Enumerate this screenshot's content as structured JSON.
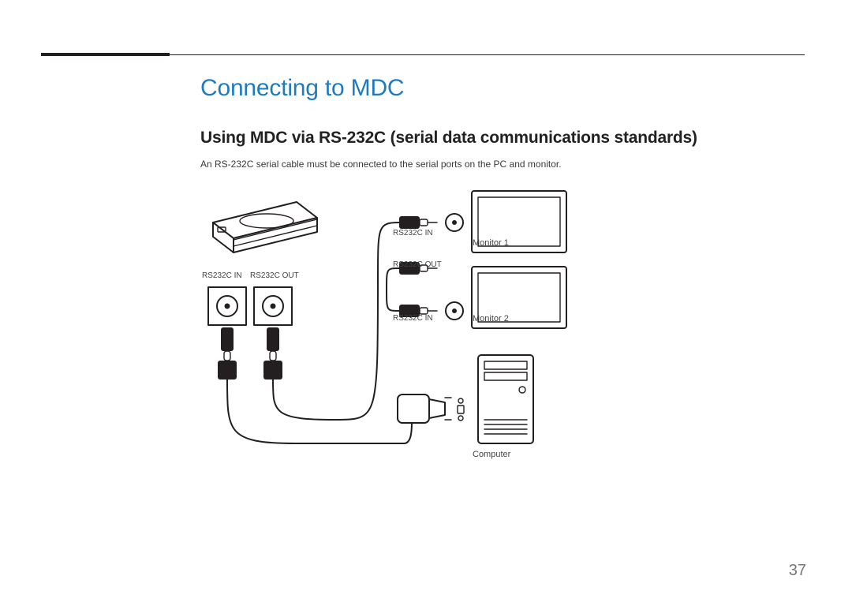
{
  "header": {
    "title": "Connecting to MDC",
    "subtitle": "Using MDC via RS-232C (serial data communications standards)",
    "note": "An RS-232C serial cable must be connected to the serial ports on the PC and monitor."
  },
  "diagram": {
    "box_label_in": "RS232C IN",
    "box_label_out": "RS232C OUT",
    "cable1_in": "RS232C IN",
    "cable1_out": "RS232C OUT",
    "cable2_in": "RS232C IN",
    "monitor1": "Monitor 1",
    "monitor2": "Monitor 2",
    "computer": "Computer"
  },
  "page_number": "37"
}
